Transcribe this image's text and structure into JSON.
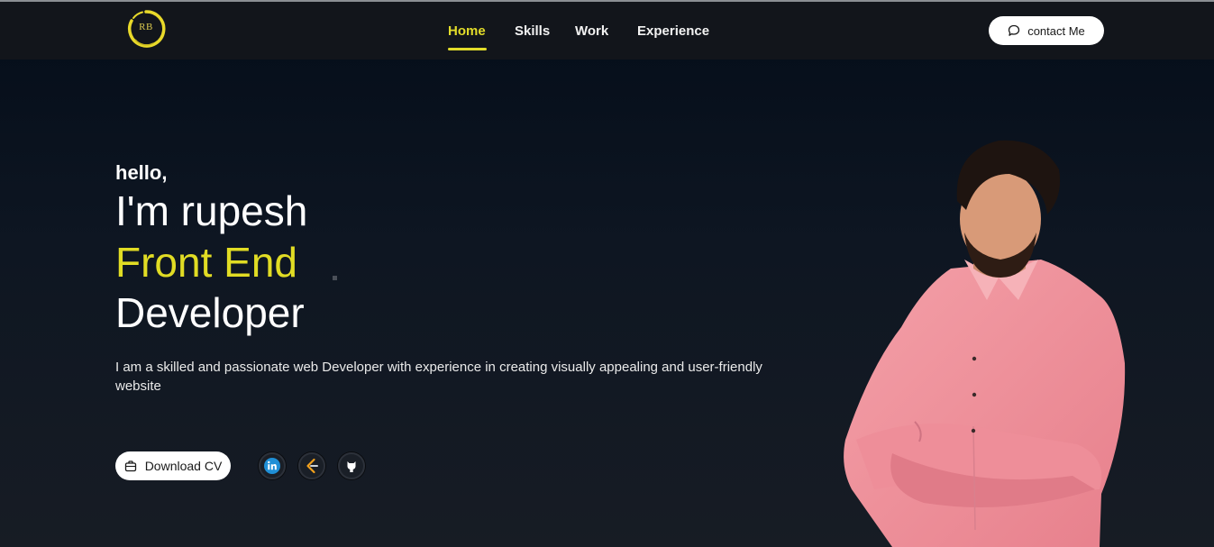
{
  "logo": {
    "text": "RB",
    "color": "#e2dc2a"
  },
  "nav": {
    "items": [
      {
        "label": "Home",
        "active": true
      },
      {
        "label": "Skills",
        "active": false
      },
      {
        "label": "Work",
        "active": false
      },
      {
        "label": "Experience",
        "active": false
      }
    ],
    "active_color": "#e2dc2a"
  },
  "contact": {
    "label": "contact Me",
    "icon": "chat-bubble-icon"
  },
  "hero": {
    "greeting": "hello,",
    "name_line": "I'm rupesh",
    "role_line1": "Front End",
    "role_line2": "Developer",
    "description": "I am a skilled and passionate web Developer with experience in creating visually appealing and user-friendly website",
    "download_label": "Download CV",
    "download_icon": "briefcase-icon",
    "accent_color": "#e1dc24"
  },
  "socials": [
    {
      "name": "linkedin",
      "icon": "linkedin-icon"
    },
    {
      "name": "leetcode",
      "icon": "leetcode-icon"
    },
    {
      "name": "github",
      "icon": "github-icon"
    }
  ],
  "photo": {
    "subject": "portrait-man-pink-shirt-arms-crossed"
  }
}
